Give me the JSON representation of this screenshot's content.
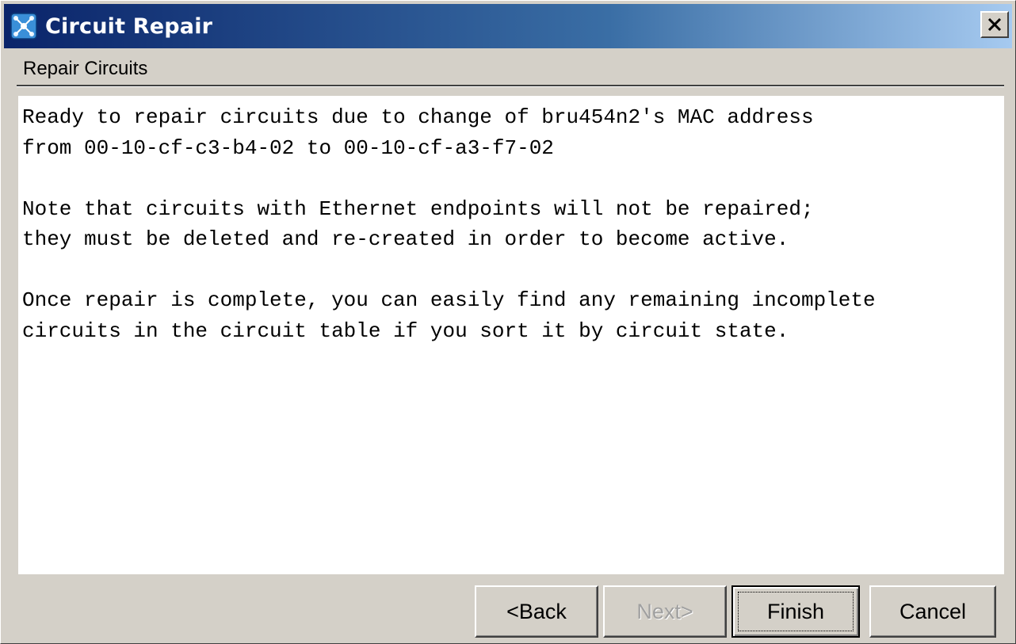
{
  "window": {
    "title": "Circuit Repair",
    "icon": "circuit-network-icon",
    "close_icon": "close-icon",
    "accent_color": "#0a246a"
  },
  "section": {
    "heading": "Repair Circuits"
  },
  "message_lines": [
    "Ready to repair circuits due to change of bru454n2's MAC address",
    "from 00-10-cf-c3-b4-02 to 00-10-cf-a3-f7-02",
    "",
    "Note that circuits with Ethernet endpoints will not be repaired;",
    "they must be deleted and re-created in order to become active.",
    "",
    "Once repair is complete, you can easily find any remaining incomplete",
    "circuits in the circuit table if you sort it by circuit state."
  ],
  "buttons": {
    "back": "<Back",
    "next": "Next>",
    "finish": "Finish",
    "cancel": "Cancel"
  },
  "states": {
    "next_enabled": false,
    "default_button": "Finish"
  }
}
